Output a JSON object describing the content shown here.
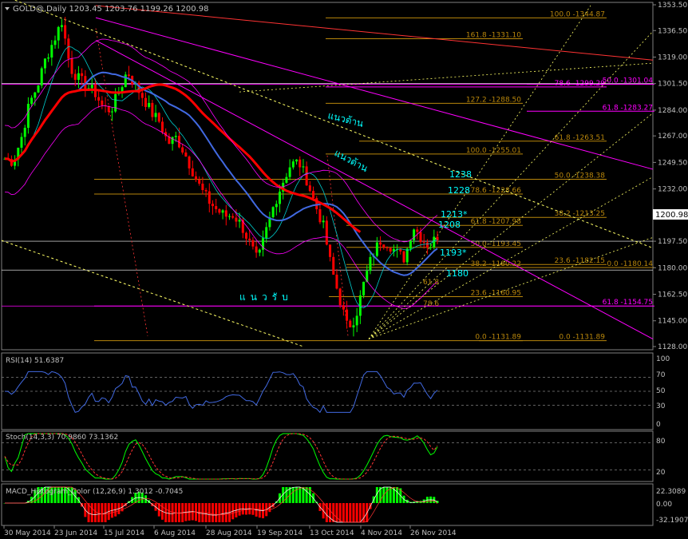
{
  "header": {
    "symbol_line": "GOLD@,Daily  1203.45 1203.76 1199.26 1200.98",
    "price_box": "1200.98"
  },
  "colors": {
    "background": "#000000",
    "grid": "#808080",
    "bull_candle": "#00ff00",
    "bear_candle": "#ff0000",
    "fib": "#b8860b",
    "fib_magenta": "#ff00ff",
    "ma_red": "#ff0000",
    "ma_blue": "#4169e1",
    "bands": "#ff00ff",
    "cyan_text": "#00ffff",
    "trend_yellow": "#ffff66",
    "rsi_line": "#4169e1",
    "stoch_main": "#00ff00",
    "stoch_signal": "#ff3333",
    "macd_pos": "#00ff00",
    "macd_neg": "#ff0000"
  },
  "main_axis": {
    "ticks": [
      "1353.50",
      "1336.50",
      "1319.00",
      "1301.50",
      "1284.00",
      "1267.00",
      "1249.50",
      "1232.00",
      "1214.50",
      "1197.50",
      "1180.00",
      "1162.50",
      "1145.00",
      "1128.00"
    ]
  },
  "date_labels": [
    "30 May 2014",
    "23 Jun 2014",
    "15 Jul 2014",
    "6 Aug 2014",
    "28 Aug 2014",
    "19 Sep 2014",
    "13 Oct 2014",
    "4 Nov 2014",
    "26 Nov 2014"
  ],
  "fib_labels": [
    {
      "text": "100.0 -1344.87",
      "price": 1344.87,
      "color": "fib"
    },
    {
      "text": "161.8 -1331.10",
      "price": 1331.1,
      "color": "fib"
    },
    {
      "text": "78.6 -1299.29",
      "price": 1299.29,
      "color": "fib_magenta"
    },
    {
      "text": "50.0 -1301.04",
      "price": 1301.04,
      "color": "fib_magenta"
    },
    {
      "text": "127.2 -1288.50",
      "price": 1288.5,
      "color": "fib"
    },
    {
      "text": "61.8 -1283.27",
      "price": 1283.27,
      "color": "fib_magenta"
    },
    {
      "text": "61.8 -1263.51",
      "price": 1263.51,
      "color": "fib"
    },
    {
      "text": "100.0 -1255.01",
      "price": 1255.01,
      "color": "fib"
    },
    {
      "text": "50.0 -1238.38",
      "price": 1238.38,
      "color": "fib"
    },
    {
      "text": "78.6 -1228.66",
      "price": 1228.66,
      "color": "fib"
    },
    {
      "text": "38.2 -1213.25",
      "price": 1213.25,
      "color": "fib"
    },
    {
      "text": "61.8 -1207.98",
      "price": 1207.98,
      "color": "fib"
    },
    {
      "text": "50.0 -1193.45",
      "price": 1193.45,
      "color": "fib"
    },
    {
      "text": "23.6 -1182.15",
      "price": 1182.15,
      "color": "fib"
    },
    {
      "text": "38.2 -1180.22",
      "price": 1180.22,
      "color": "fib"
    },
    {
      "text": "0.0 -1180.14",
      "price": 1180.14,
      "color": "fib"
    },
    {
      "text": "23.6 -1160.95",
      "price": 1160.95,
      "color": "fib"
    },
    {
      "text": "61.8 -1154.75",
      "price": 1154.75,
      "color": "fib_magenta"
    },
    {
      "text": "0.0 -1131.89",
      "price": 1131.89,
      "color": "fib"
    },
    {
      "text": "0.0 -1131.89",
      "price": 1131.89,
      "color": "fib"
    }
  ],
  "level_labels": [
    "1238",
    "1228",
    "1213*",
    "1208",
    "1193*",
    "1180"
  ],
  "small_fib_labels": [
    "61.8",
    "78.6"
  ],
  "thai_labels": [
    "แนวต้าน",
    "แนวต้าน",
    "แนวรับ"
  ],
  "rsi": {
    "title": "RSI(14) 51.6387",
    "ticks": [
      "100",
      "70",
      "50",
      "30",
      "0"
    ]
  },
  "stoch": {
    "title": "Stoch(14,3,3) 70.9860 73.1362",
    "ticks": [
      "80",
      "20"
    ]
  },
  "macd": {
    "title": "MACD_Histogram_Color (12,26,9)  1.3012 -0.7045",
    "ticks": [
      "22.3089",
      "0.00",
      "-32.1907"
    ]
  },
  "chart_data": {
    "type": "candlestick",
    "title": "GOLD@,Daily",
    "ohlc_last": {
      "open": 1203.45,
      "high": 1203.76,
      "low": 1199.26,
      "close": 1200.98
    },
    "ylim": [
      1128.0,
      1353.5
    ],
    "x_dates": [
      "30 May 2014",
      "23 Jun 2014",
      "15 Jul 2014",
      "6 Aug 2014",
      "28 Aug 2014",
      "19 Sep 2014",
      "13 Oct 2014",
      "4 Nov 2014",
      "26 Nov 2014"
    ],
    "close_path": [
      1252,
      1250,
      1265,
      1288,
      1300,
      1318,
      1330,
      1343,
      1312,
      1305,
      1300,
      1296,
      1286,
      1284,
      1296,
      1310,
      1300,
      1292,
      1282,
      1276,
      1262,
      1266,
      1256,
      1244,
      1232,
      1224,
      1218,
      1214,
      1215,
      1208,
      1196,
      1184,
      1204,
      1222,
      1236,
      1248,
      1250,
      1238,
      1222,
      1208,
      1180,
      1160,
      1140,
      1148,
      1170,
      1188,
      1198,
      1196,
      1190,
      1186,
      1208,
      1200,
      1194,
      1201
    ],
    "rsi_value": 51.6387,
    "stoch_main": 70.986,
    "stoch_signal": 73.1362,
    "macd_value": 1.3012,
    "macd_signal": -0.7045
  }
}
